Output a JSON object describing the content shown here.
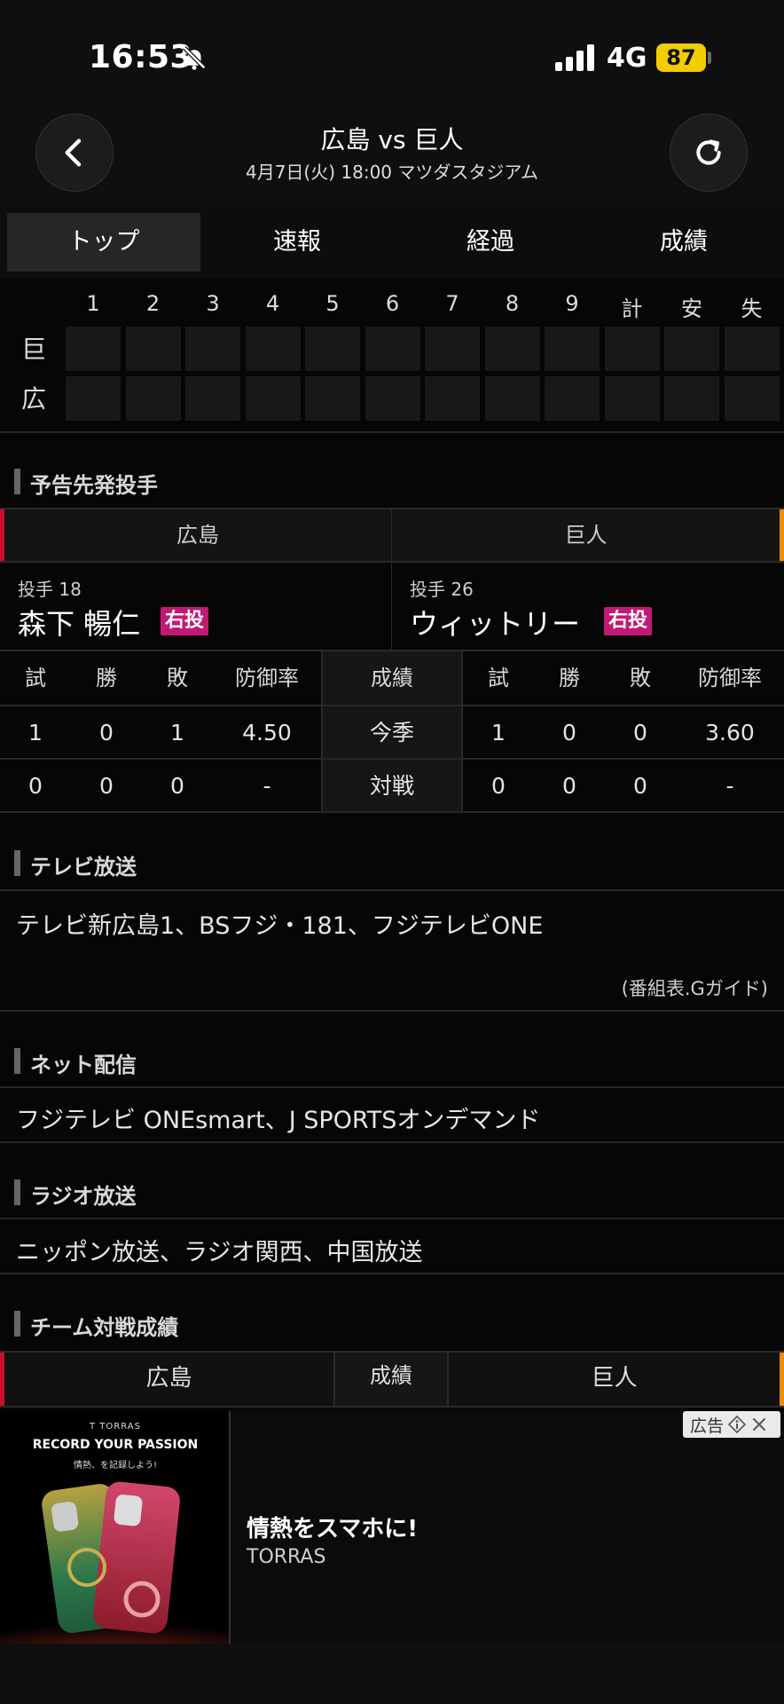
{
  "status_bar": {
    "time": "16:53",
    "network": "4G",
    "battery": "87"
  },
  "header": {
    "title": "広島 vs 巨人",
    "subtitle": "4月7日(火) 18:00 マツダスタジアム"
  },
  "tabs": [
    {
      "label": "トップ",
      "active": true
    },
    {
      "label": "速報",
      "active": false
    },
    {
      "label": "経過",
      "active": false
    },
    {
      "label": "成績",
      "active": false
    }
  ],
  "scoreboard": {
    "headers": [
      "1",
      "2",
      "3",
      "4",
      "5",
      "6",
      "7",
      "8",
      "9",
      "計",
      "安",
      "失"
    ],
    "teams": [
      "巨",
      "広"
    ]
  },
  "starting_pitchers": {
    "section_title": "予告先発投手",
    "home_team": "広島",
    "away_team": "巨人",
    "home": {
      "number": "投手 18",
      "name": "森下 暢仁",
      "throws": "右投"
    },
    "away": {
      "number": "投手 26",
      "name": "ウィットリー",
      "throws": "右投"
    },
    "stat_headers": [
      "試",
      "勝",
      "敗",
      "防御率"
    ],
    "middle_header": "成績",
    "rows": [
      {
        "label": "今季",
        "home": [
          "1",
          "0",
          "1",
          "4.50"
        ],
        "away": [
          "1",
          "0",
          "0",
          "3.60"
        ]
      },
      {
        "label": "対戦",
        "home": [
          "0",
          "0",
          "0",
          "-"
        ],
        "away": [
          "0",
          "0",
          "0",
          "-"
        ]
      }
    ]
  },
  "tv": {
    "section_title": "テレビ放送",
    "text": "テレビ新広島1、BSフジ・181、フジテレビONE",
    "source": "(番組表.Gガイド)"
  },
  "net": {
    "section_title": "ネット配信",
    "text": "フジテレビ ONEsmart、J SPORTSオンデマンド"
  },
  "radio": {
    "section_title": "ラジオ放送",
    "text": "ニッポン放送、ラジオ関西、中国放送"
  },
  "team_record": {
    "section_title": "チーム対戦成績",
    "home": "広島",
    "middle": "成績",
    "away": "巨人"
  },
  "ad": {
    "label": "広告",
    "image_brand": "T TORRAS",
    "image_tagline": "RECORD YOUR PASSION",
    "image_subtitle": "情熱、を記録しよう!",
    "title": "情熱をスマホに!",
    "advertiser": "TORRAS"
  },
  "colors": {
    "home_accent": "#c8102e",
    "away_accent": "#f08c00",
    "badge": "#c11a74",
    "battery": "#f2cd00"
  }
}
